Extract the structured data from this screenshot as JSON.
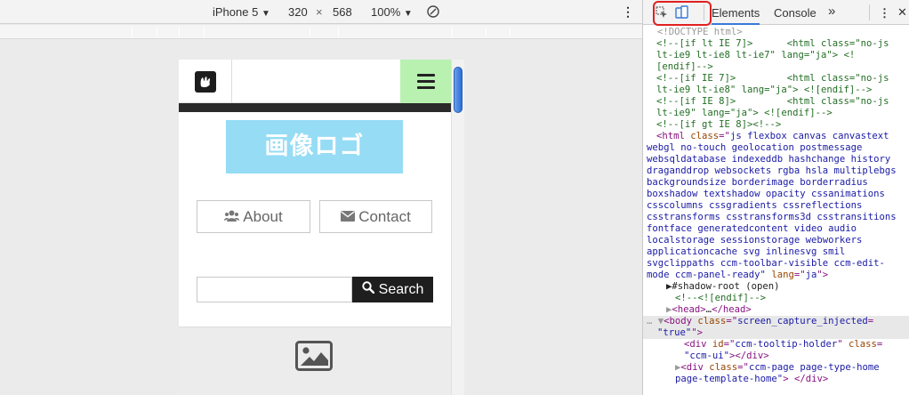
{
  "emulator": {
    "device": "iPhone 5",
    "width": "320",
    "times": "×",
    "height": "568",
    "zoom": "100%",
    "dropdown_arrow": "▼"
  },
  "devtools": {
    "tabs": [
      "Elements",
      "Console"
    ],
    "more": "»",
    "kebab": "⋮",
    "code_lines": [
      {
        "cls": "g",
        "indent": 0,
        "text": "<!DOCTYPE html>"
      },
      {
        "cls": "c",
        "indent": 0,
        "text": "<!--[if lt IE 7]>      <html class=\"no-js"
      },
      {
        "cls": "c",
        "indent": 0,
        "text": "lt-ie9 lt-ie8 lt-ie7\" lang=\"ja\"> <!"
      },
      {
        "cls": "c",
        "indent": 0,
        "text": "[endif]-->"
      },
      {
        "cls": "c",
        "indent": 0,
        "text": "<!--[if IE 7]>         <html class=\"no-js"
      },
      {
        "cls": "c",
        "indent": 0,
        "text": "lt-ie9 lt-ie8\" lang=\"ja\"> <![endif]-->"
      },
      {
        "cls": "c",
        "indent": 0,
        "text": "<!--[if IE 8]>         <html class=\"no-js"
      },
      {
        "cls": "c",
        "indent": 0,
        "text": "lt-ie9\" lang=\"ja\"> <![endif]-->"
      },
      {
        "cls": "c",
        "indent": 0,
        "text": "<!--[if gt IE 8]><!-->"
      },
      {
        "cls": "mix",
        "indent": 0,
        "parts": [
          {
            "c": "tag",
            "t": "<html "
          },
          {
            "c": "attr",
            "t": "class"
          },
          {
            "c": "tag",
            "t": "=\""
          },
          {
            "c": "val",
            "t": "js flexbox canvas canvastext"
          }
        ]
      },
      {
        "cls": "val",
        "indent": -1,
        "text": "webgl no-touch geolocation postmessage"
      },
      {
        "cls": "val",
        "indent": -1,
        "text": "websqldatabase indexeddb hashchange history"
      },
      {
        "cls": "val",
        "indent": -1,
        "text": "draganddrop websockets rgba hsla multiplebgs"
      },
      {
        "cls": "val",
        "indent": -1,
        "text": "backgroundsize borderimage borderradius"
      },
      {
        "cls": "val",
        "indent": -1,
        "text": "boxshadow textshadow opacity cssanimations"
      },
      {
        "cls": "val",
        "indent": -1,
        "text": "csscolumns cssgradients cssreflections"
      },
      {
        "cls": "val",
        "indent": -1,
        "text": "csstransforms csstransforms3d csstransitions"
      },
      {
        "cls": "val",
        "indent": -1,
        "text": "fontface generatedcontent video audio"
      },
      {
        "cls": "val",
        "indent": -1,
        "text": "localstorage sessionstorage webworkers"
      },
      {
        "cls": "val",
        "indent": -1,
        "text": "applicationcache svg inlinesvg smil"
      },
      {
        "cls": "val",
        "indent": -1,
        "text": "svgclippaths ccm-toolbar-visible ccm-edit-"
      },
      {
        "cls": "mix",
        "indent": -1,
        "parts": [
          {
            "c": "val",
            "t": "mode ccm-panel-ready\" "
          },
          {
            "c": "attr",
            "t": "lang"
          },
          {
            "c": "tag",
            "t": "=\""
          },
          {
            "c": "val",
            "t": "ja"
          },
          {
            "c": "tag",
            "t": "\">"
          }
        ]
      },
      {
        "cls": "plain",
        "indent": 1,
        "text": "▶#shadow-root (open)"
      },
      {
        "cls": "c",
        "indent": 2,
        "text": "<!--<![endif]-->"
      },
      {
        "cls": "mix",
        "indent": 1,
        "parts": [
          {
            "c": "g",
            "t": "▶"
          },
          {
            "c": "tag",
            "t": "<head>"
          },
          {
            "c": "plain",
            "t": "…"
          },
          {
            "c": "tag",
            "t": "</head>"
          }
        ]
      },
      {
        "cls": "mix sel",
        "indent": 0,
        "parts": [
          {
            "c": "g",
            "t": "… ▼"
          },
          {
            "c": "tag",
            "t": "<body "
          },
          {
            "c": "attr",
            "t": "class"
          },
          {
            "c": "tag",
            "t": "=\""
          },
          {
            "c": "val",
            "t": "screen_capture_injected"
          },
          {
            "c": "tag",
            "t": "="
          }
        ]
      },
      {
        "cls": "mix sel",
        "indent": 1,
        "parts": [
          {
            "c": "val",
            "t": "\"true\""
          },
          {
            "c": "tag",
            "t": "\">"
          }
        ]
      },
      {
        "cls": "mix",
        "indent": 3,
        "parts": [
          {
            "c": "tag",
            "t": "<div "
          },
          {
            "c": "attr",
            "t": "id"
          },
          {
            "c": "tag",
            "t": "=\""
          },
          {
            "c": "val",
            "t": "ccm-tooltip-holder"
          },
          {
            "c": "tag",
            "t": "\" "
          },
          {
            "c": "attr",
            "t": "class"
          },
          {
            "c": "tag",
            "t": "="
          }
        ]
      },
      {
        "cls": "mix",
        "indent": 3,
        "parts": [
          {
            "c": "val",
            "t": "\"ccm-ui\""
          },
          {
            "c": "tag",
            "t": "></div>"
          }
        ]
      },
      {
        "cls": "mix",
        "indent": 2,
        "parts": [
          {
            "c": "g",
            "t": "▶"
          },
          {
            "c": "tag",
            "t": "<div "
          },
          {
            "c": "attr",
            "t": "class"
          },
          {
            "c": "tag",
            "t": "=\""
          },
          {
            "c": "val",
            "t": "ccm-page page-type-home"
          }
        ]
      },
      {
        "cls": "mix",
        "indent": 2,
        "parts": [
          {
            "c": "val",
            "t": "page-template-home\""
          },
          {
            "c": "tag",
            "t": "> </div>"
          }
        ]
      }
    ]
  },
  "page": {
    "logo_text": "画像ロゴ",
    "about_label": "About",
    "contact_label": "Contact",
    "search_label": "Search",
    "search_value": ""
  },
  "colors": {
    "menu_button": "#b8f1b0",
    "logo_bg": "#95dcf4",
    "highlight": "#e02020"
  }
}
